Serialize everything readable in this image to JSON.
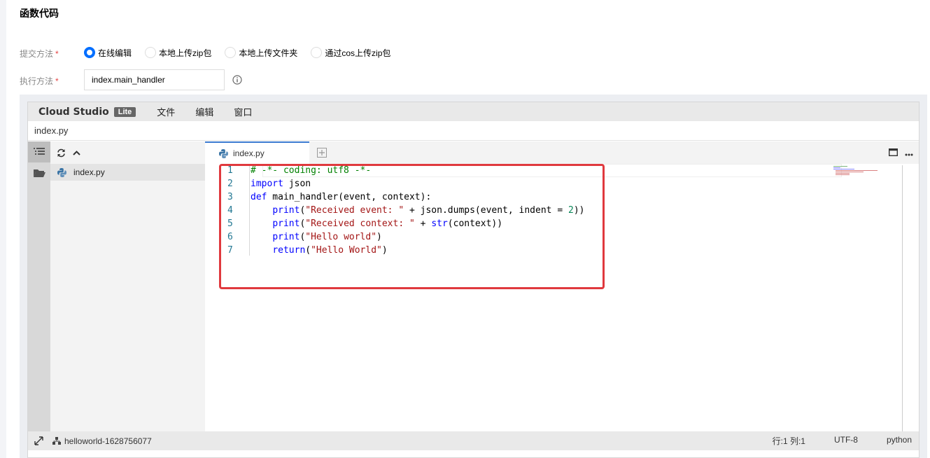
{
  "section_title": "函数代码",
  "form": {
    "submit_label": "提交方法",
    "exec_label": "执行方法",
    "required_mark": "*",
    "submit_options": [
      {
        "label": "在线编辑",
        "selected": true
      },
      {
        "label": "本地上传zip包",
        "selected": false
      },
      {
        "label": "本地上传文件夹",
        "selected": false
      },
      {
        "label": "通过cos上传zip包",
        "selected": false
      }
    ],
    "handler_value": "index.main_handler"
  },
  "ide": {
    "brand": "Cloud Studio",
    "badge": "Lite",
    "menu": [
      "文件",
      "编辑",
      "窗口"
    ],
    "file_path": "index.py",
    "explorer_file": "index.py",
    "tab_label": "index.py",
    "code_lines": [
      {
        "n": "1"
      },
      {
        "n": "2"
      },
      {
        "n": "3"
      },
      {
        "n": "4"
      },
      {
        "n": "5"
      },
      {
        "n": "6"
      },
      {
        "n": "7"
      }
    ],
    "status": {
      "project": "helloworld-1628756077",
      "cursor": "行:1 列:1",
      "encoding": "UTF-8",
      "language": "python"
    }
  },
  "colors": {
    "accent": "#006eff",
    "highlight_border": "#e0393e"
  }
}
